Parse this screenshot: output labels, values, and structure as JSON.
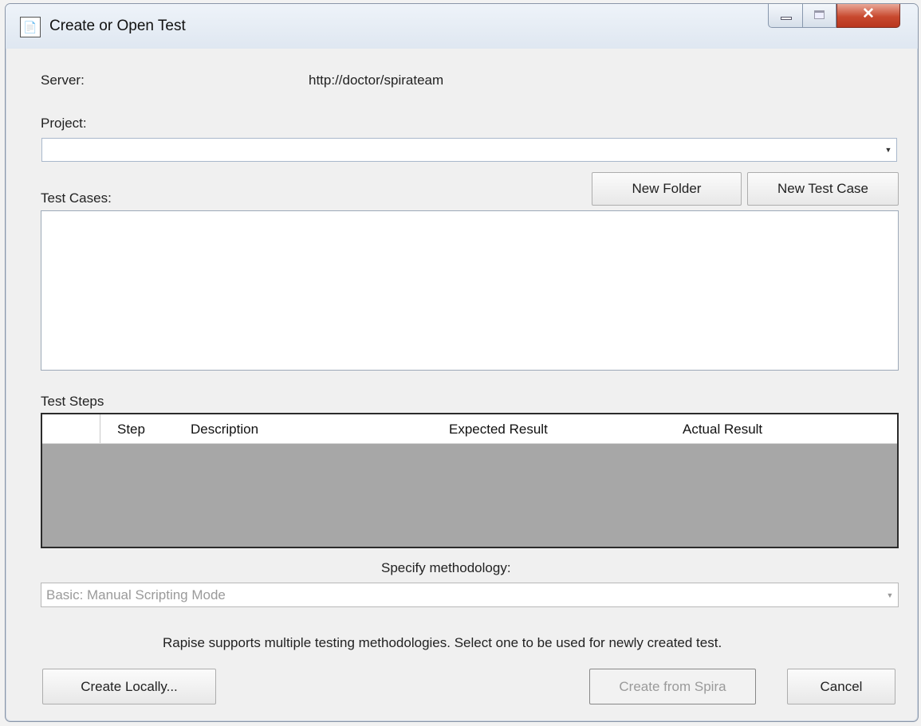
{
  "window": {
    "title": "Create or Open Test"
  },
  "server": {
    "label": "Server:",
    "value": "http://doctor/spirateam"
  },
  "project": {
    "label": "Project:",
    "value": ""
  },
  "test_cases": {
    "label": "Test Cases:",
    "new_folder_label": "New Folder",
    "new_test_case_label": "New Test Case"
  },
  "test_steps": {
    "label": "Test Steps",
    "columns": [
      "Step",
      "Description",
      "Expected Result",
      "Actual Result"
    ]
  },
  "methodology": {
    "label": "Specify methodology:",
    "selected": "Basic: Manual Scripting Mode",
    "hint": "Rapise supports multiple testing methodologies. Select one to be used for newly created test."
  },
  "footer": {
    "create_locally_label": "Create Locally...",
    "create_from_spira_label": "Create from Spira",
    "cancel_label": "Cancel"
  },
  "icons": {
    "app": "app-document-icon",
    "minimize": "minimize-icon",
    "maximize": "maximize-icon",
    "close": "close-icon",
    "dropdown": "chevron-down-icon"
  },
  "colors": {
    "grid_background": "#a7a7a7",
    "close_button": "#c8492f"
  }
}
